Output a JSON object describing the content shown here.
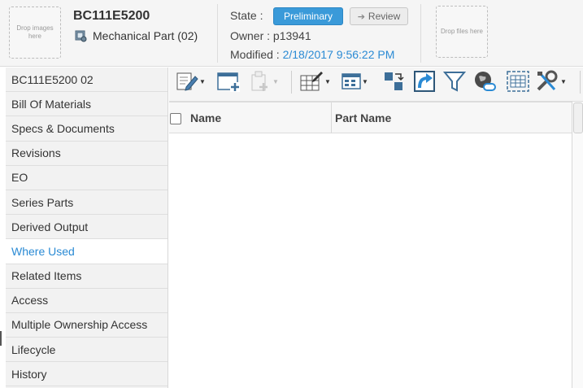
{
  "header": {
    "drop_images": "Drop images here",
    "part_number": "BC111E5200",
    "part_type": "Mechanical Part (02)",
    "state_label": "State :",
    "state_value": "Preliminary",
    "next_state": "Review",
    "owner_text": "Owner : p13941",
    "modified_label": "Modified : ",
    "modified_value": "2/18/2017 9:56:22 PM",
    "drop_files": "Drop files here"
  },
  "sidebar": {
    "items": [
      {
        "label": "BC111E5200 02"
      },
      {
        "label": "Bill Of Materials"
      },
      {
        "label": "Specs & Documents"
      },
      {
        "label": "Revisions"
      },
      {
        "label": "EO"
      },
      {
        "label": "Series Parts"
      },
      {
        "label": "Derived Output"
      },
      {
        "label": "Where Used"
      },
      {
        "label": "Related Items"
      },
      {
        "label": "Access"
      },
      {
        "label": "Multiple Ownership Access"
      },
      {
        "label": "Lifecycle"
      },
      {
        "label": "History"
      }
    ],
    "active": "Where Used"
  },
  "toolbar": {
    "icons": [
      "edit-icon",
      "new-window-icon",
      "add-disabled-icon",
      "table-edit-icon",
      "view-grid-icon",
      "move-icon",
      "redirect-icon",
      "filter-icon",
      "web-link-icon",
      "select-table-icon",
      "tools-icon"
    ]
  },
  "table": {
    "columns": [
      "Name",
      "Part Name"
    ],
    "rows": []
  },
  "colors": {
    "accent": "#2a8ad4",
    "state_button": "#3a9ad9"
  }
}
